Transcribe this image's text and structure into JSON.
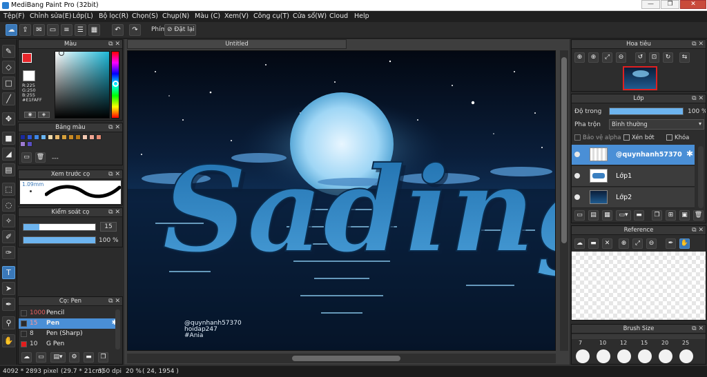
{
  "window": {
    "title": "MediBang Paint Pro (32bit)",
    "min": "—",
    "max": "❐",
    "close": "✕"
  },
  "menu": [
    "Tệp(F)",
    "Chỉnh sửa(E)",
    "Lớp(L)",
    "Bộ lọc(R)",
    "Chọn(S)",
    "Chụp(N)",
    "Màu (C)",
    "Xem(V)",
    "Công cụ(T)",
    "Cửa sổ(W)",
    "Cloud",
    "Help"
  ],
  "toolbar": {
    "hotkey_label": "Phím",
    "reset_label": "Đặt lại"
  },
  "color_panel": {
    "title": "Màu",
    "readout": [
      "R:225",
      "G:250",
      "B:255",
      "#E1FAFF"
    ],
    "foreground": "#e8262b",
    "background": "#ffffff"
  },
  "palette_panel": {
    "title": "Bảng màu",
    "extra": "---",
    "swatches": [
      "#1a2a9e",
      "#2e57d8",
      "#3f86e6",
      "#6ab6f2",
      "#f0d9a8",
      "#e7b86b",
      "#d6a03b",
      "#c98a24",
      "#b87a18",
      "#f3c9b3",
      "#f0a593",
      "#e58a73",
      "#9d7bd0",
      "#5a4fc5"
    ]
  },
  "brush_preview": {
    "title": "Xem trước cọ",
    "size": "1.09mm"
  },
  "brush_control": {
    "title": "Kiểm soát cọ",
    "size": 15,
    "size_fraction": 0.22,
    "opacity": "100 %",
    "opacity_fraction": 1.0
  },
  "brush_list": {
    "title": "Cọ: Pen",
    "items": [
      {
        "size": "1000",
        "name": "Pencil",
        "selected": false,
        "color": "#2b2b2b",
        "red": true
      },
      {
        "size": "15",
        "name": "Pen",
        "selected": true,
        "color": "#2b2b2b",
        "red": true
      },
      {
        "size": "8",
        "name": "Pen (Sharp)",
        "selected": false,
        "color": "#2b2b2b",
        "red": false
      },
      {
        "size": "10",
        "name": "G Pen",
        "selected": false,
        "color": "#e21d1d",
        "red": false
      }
    ]
  },
  "canvas": {
    "tab": "Untitled",
    "art_text": "Sading",
    "credits": [
      "@quynhanh57370",
      "hoidap247",
      "#Ania"
    ]
  },
  "navigator": {
    "title": "Hoa tiêu"
  },
  "layers": {
    "title": "Lớp",
    "opacity_label": "Độ trong",
    "opacity_value": "100 %",
    "opacity_fraction": 1.0,
    "blend_label": "Pha trộn",
    "blend_value": "Bình thường",
    "protect_alpha": "Bảo vệ alpha",
    "clipping": "Xén bớt",
    "lock": "Khóa",
    "items": [
      {
        "name": "@quynhanh57370",
        "selected": true
      },
      {
        "name": "Lớp1",
        "selected": false
      },
      {
        "name": "Lớp2",
        "selected": false
      }
    ]
  },
  "reference": {
    "title": "Reference"
  },
  "brush_size": {
    "title": "Brush Size",
    "sizes": [
      "7",
      "10",
      "12",
      "15",
      "20",
      "25"
    ]
  },
  "status": {
    "dimensions": "4092 * 2893 pixel",
    "paper": "(29.7 * 21cm)",
    "dpi": "350 dpi",
    "zoom": "20 %",
    "coords": "( 24, 1954 )"
  }
}
